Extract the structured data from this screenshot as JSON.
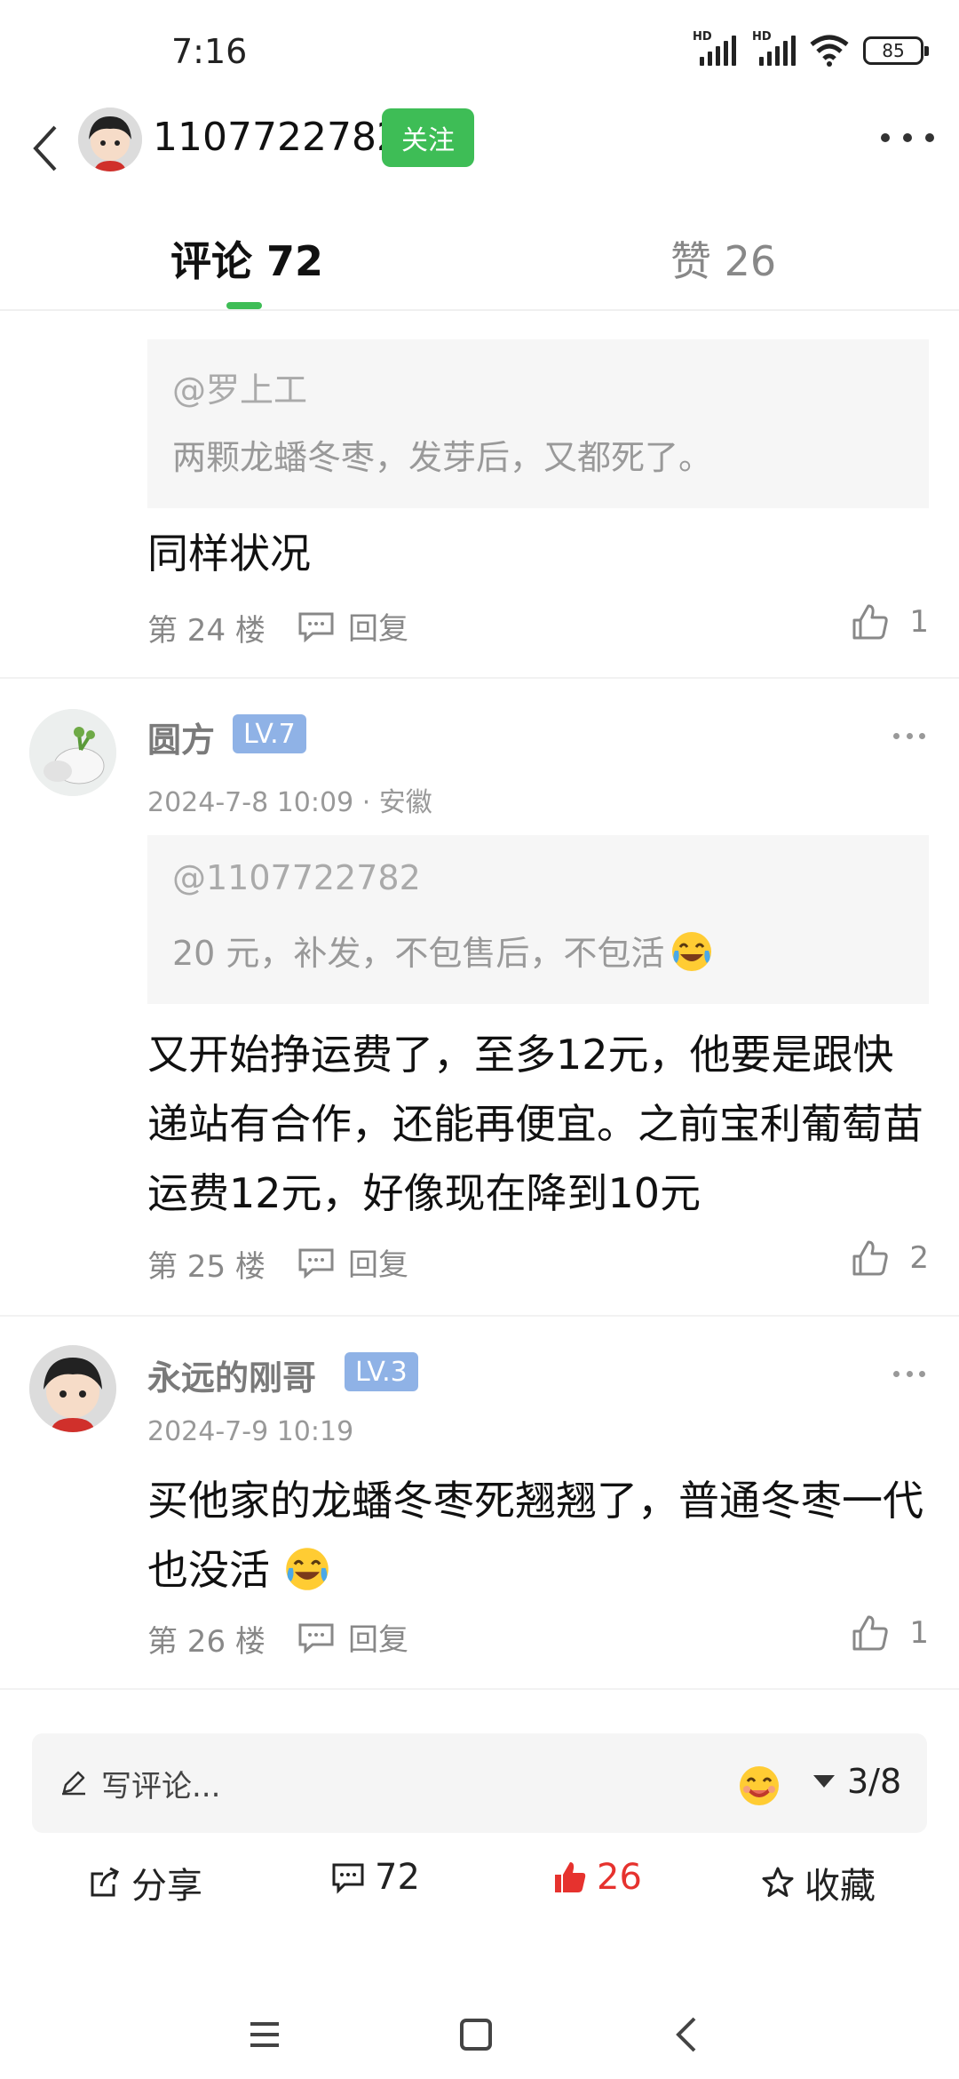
{
  "status_bar": {
    "time": "7:16",
    "battery": "85",
    "net1": "HD",
    "net2": "HD"
  },
  "header": {
    "username": "1107722782",
    "follow_label": "关注"
  },
  "tabs": {
    "comments_label": "评论 72",
    "likes_label": "赞 26"
  },
  "comments": [
    {
      "quote_at": "@罗上工",
      "quote_text": "两颗龙蟠冬枣，发芽后，又都死了。",
      "text": "同样状况",
      "floor": "第 24 楼",
      "reply_label": "回复",
      "likes": "1"
    },
    {
      "name": "圆方",
      "level": "LV.7",
      "meta": "2024-7-8 10:09 · 安徽",
      "quote_at": "@1107722782",
      "quote_text": "20 元，补发，不包售后，不包活",
      "text": "又开始挣运费了，至多12元，他要是跟快递站有合作，还能再便宜。之前宝利葡萄苗运费12元，好像现在降到10元",
      "floor": "第 25 楼",
      "reply_label": "回复",
      "likes": "2"
    },
    {
      "name": "永远的刚哥",
      "level": "LV.3",
      "meta": "2024-7-9 10:19",
      "text": "买他家的龙蟠冬枣死翘翘了，普通冬枣一代也没活",
      "floor": "第 26 楼",
      "reply_label": "回复",
      "likes": "1"
    }
  ],
  "input": {
    "placeholder": "写评论...",
    "page": "3/8"
  },
  "actions": {
    "share": "分享",
    "comments": "72",
    "likes": "26",
    "favorite": "收藏"
  },
  "colors": {
    "accent": "#3ebd56",
    "like_red": "#e6322e",
    "level_badge": "#8fb2e6"
  }
}
